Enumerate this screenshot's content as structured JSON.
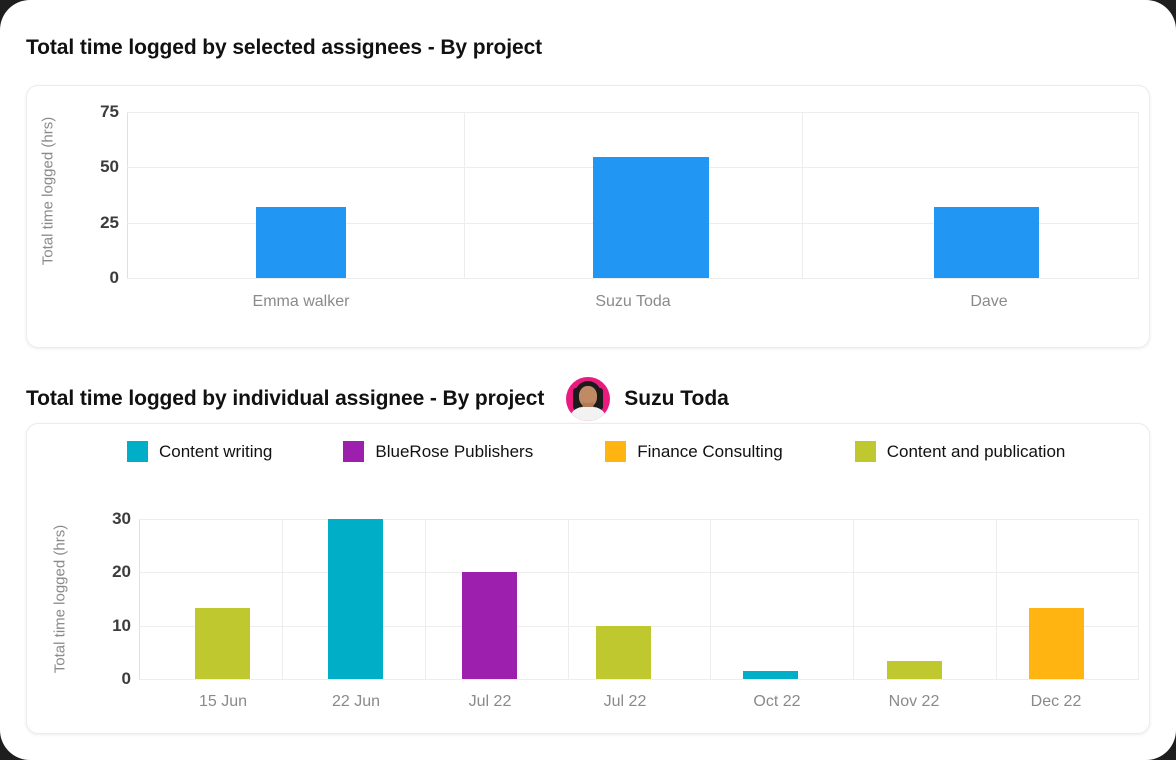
{
  "section1": {
    "title": "Total time logged by selected assignees - By project"
  },
  "section2": {
    "title": "Total time logged by individual assignee - By project",
    "assignee_name": "Suzu Toda",
    "avatar_icon": "user-avatar-photo",
    "avatar_bg_color": "#ea1a7f"
  },
  "legend": {
    "items": [
      {
        "label": "Content writing",
        "color": "#00AEC7"
      },
      {
        "label": "BlueRose Publishers",
        "color": "#9C1FAE"
      },
      {
        "label": "Finance Consulting",
        "color": "#FFB412"
      },
      {
        "label": "Content and publication",
        "color": "#BFC92F"
      }
    ]
  },
  "chart_data": [
    {
      "type": "bar",
      "title": "Total time logged by selected assignees - By project",
      "xlabel": "",
      "ylabel": "Total time  logged (hrs)",
      "categories": [
        "Emma walker",
        "Suzu Toda",
        "Dave"
      ],
      "values": [
        34,
        58.5,
        34
      ],
      "colors": [
        "#2196F3",
        "#2196F3",
        "#2196F3"
      ],
      "ylim": [
        0,
        80
      ],
      "yticks": [
        0,
        25,
        50,
        75
      ],
      "grid": true,
      "legend": "none"
    },
    {
      "type": "bar",
      "title": "Total time logged by individual assignee - By project",
      "xlabel": "",
      "ylabel": "Total time  logged (hrs)",
      "categories": [
        "15 Jun",
        "22 Jun",
        "Jul 22",
        "Jul 22",
        "Oct 22",
        "Nov 22",
        "Dec 22"
      ],
      "values": [
        13.3,
        30,
        20,
        10,
        1.5,
        3.3,
        13.3
      ],
      "series_names": [
        "Content and publication",
        "Content writing",
        "BlueRose Publishers",
        "Content and publication",
        "Content writing",
        "Content and publication",
        "Finance Consulting"
      ],
      "colors": [
        "#BFC92F",
        "#00AEC7",
        "#9C1FAE",
        "#BFC92F",
        "#00AEC7",
        "#BFC92F",
        "#FFB412"
      ],
      "ylim": [
        0,
        33
      ],
      "yticks": [
        0,
        10,
        20,
        30
      ],
      "grid": true,
      "legend": "top",
      "legend_entries": [
        "Content writing",
        "BlueRose Publishers",
        "Finance Consulting",
        "Content and publication"
      ]
    }
  ]
}
